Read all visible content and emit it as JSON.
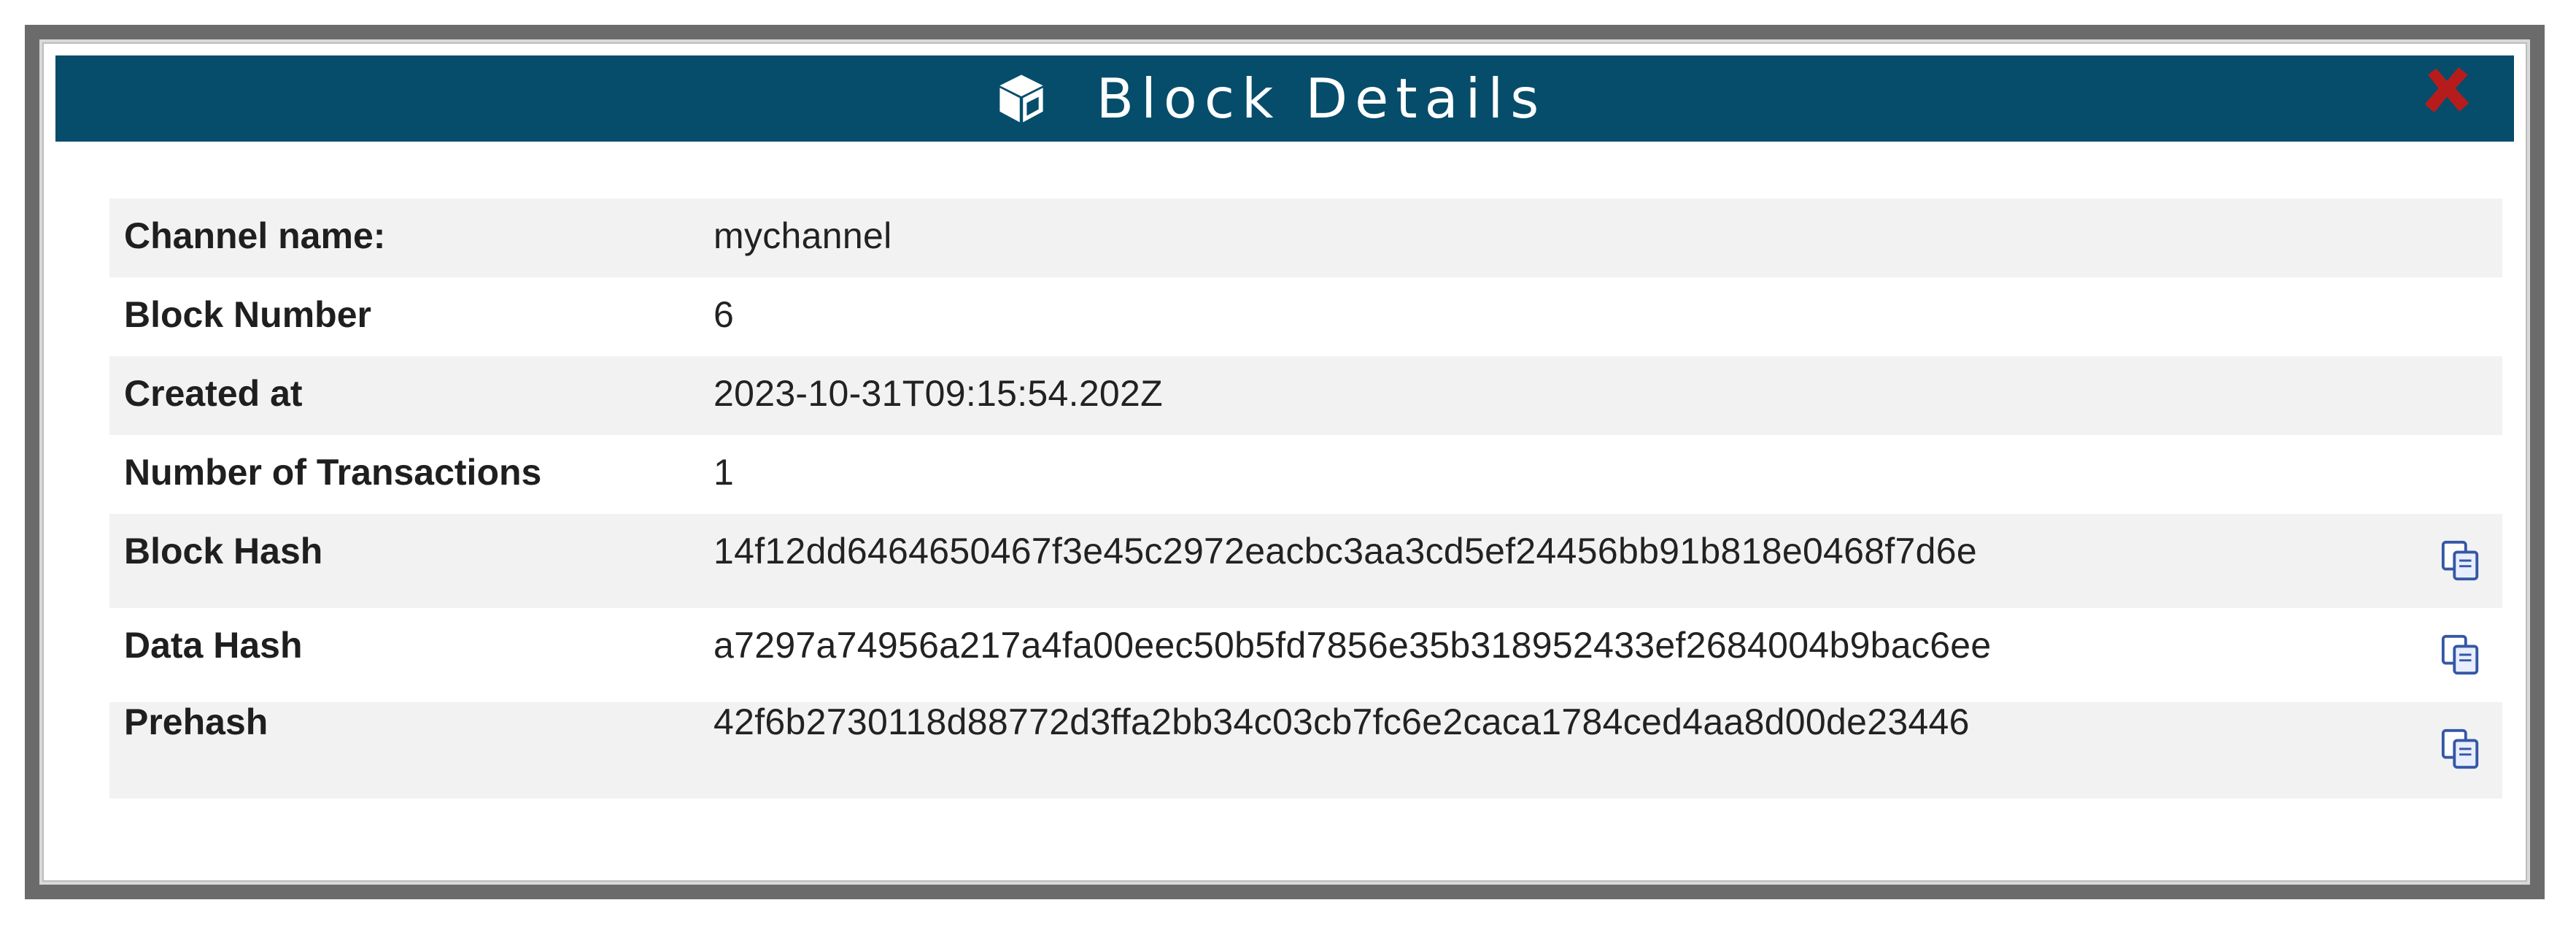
{
  "dialog": {
    "title": "Block Details",
    "header_color": "#054d6b",
    "close_color": "#b71c1c",
    "header_icon": "cube-icon",
    "close_icon": "close-icon"
  },
  "details": [
    {
      "label": "Channel name:",
      "value": "mychannel",
      "copyable": false
    },
    {
      "label": "Block Number",
      "value": "6",
      "copyable": false
    },
    {
      "label": "Created at",
      "value": "2023-10-31T09:15:54.202Z",
      "copyable": false
    },
    {
      "label": "Number of Transactions",
      "value": "1",
      "copyable": false
    },
    {
      "label": "Block Hash",
      "value": "14f12dd6464650467f3e45c2972eacbc3aa3cd5ef24456bb91b818e0468f7d6e",
      "copyable": true,
      "copy_icon": "copy-icon"
    },
    {
      "label": "Data Hash",
      "value": "a7297a74956a217a4fa00eec50b5fd7856e35b318952433ef2684004b9bac6ee",
      "copyable": true,
      "copy_icon": "copy-icon"
    },
    {
      "label": "Prehash",
      "value": "42f6b2730118d88772d3ffa2bb34c03cb7fc6e2caca1784ced4aa8d00de23446",
      "copyable": true,
      "copy_icon": "copy-icon"
    }
  ]
}
